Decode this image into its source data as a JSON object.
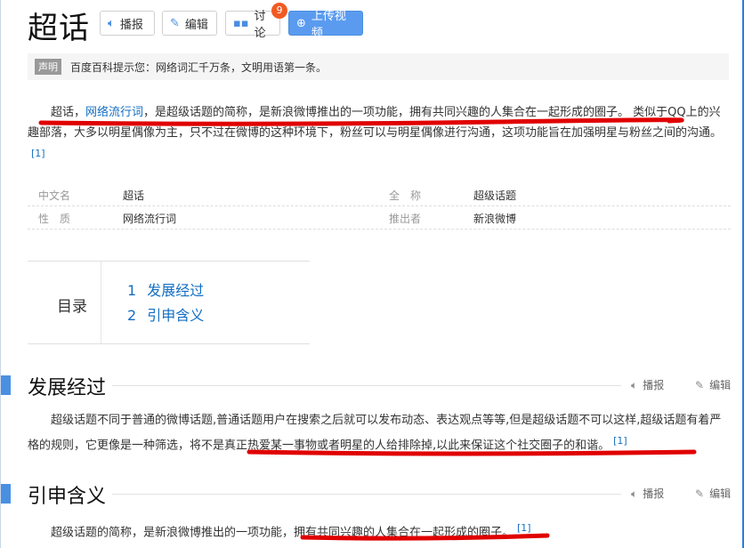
{
  "title": "超话",
  "toolbar": {
    "play_label": "播报",
    "edit_label": "编辑",
    "discuss_label": "讨论",
    "discuss_count": "9",
    "upload_label": "上传视频"
  },
  "notice": {
    "tag": "声明",
    "text": "百度百科提示您：网络词汇千万条，文明用语第一条。"
  },
  "summary": {
    "pre": "超话，",
    "link": "网络流行词",
    "rest": "，是超级话题的简称，是新浪微博推出的一项功能，拥有共同兴趣的人集合在一起形成的圈子。 类似于QQ上的兴趣部落，大多以明星偶像为主，只不过在微博的这种环境下，粉丝可以与明星偶像进行沟通，这项功能旨在加强明星与粉丝之间的沟通。",
    "ref": "[1]"
  },
  "basic_info": [
    {
      "k1": "中文名",
      "v1": "超话",
      "k2": "全　称",
      "v2": "超级话题"
    },
    {
      "k1": "性　质",
      "v1": "网络流行词",
      "k2": "推出者",
      "v2": "新浪微博"
    }
  ],
  "catalog": {
    "title": "目录",
    "items": [
      {
        "num": "1",
        "label": "发展经过"
      },
      {
        "num": "2",
        "label": "引申含义"
      }
    ]
  },
  "sections": [
    {
      "title": "发展经过",
      "play": "播报",
      "edit": "编辑",
      "text": "超级话题不同于普通的微博话题,普通话题用户在搜索之后就可以发布动态、表达观点等等,但是超级话题不可以这样,超级话题有着严格的规则，它更像是一种筛选，将不是真正热爱某一事物或者明星的人给排除掉,以此来保证这个社交圈子的和谐。",
      "ref": "[1]"
    },
    {
      "title": "引申含义",
      "play": "播报",
      "edit": "编辑",
      "text": "超级话题的简称，是新浪微博推出的一项功能，拥有共同兴趣的人集合在一起形成的圈子。",
      "ref": "[1]"
    }
  ],
  "colors": {
    "accent": "#4a90e2",
    "link": "#136ec2",
    "badge": "#f15a22",
    "annotation": "#e00000"
  }
}
